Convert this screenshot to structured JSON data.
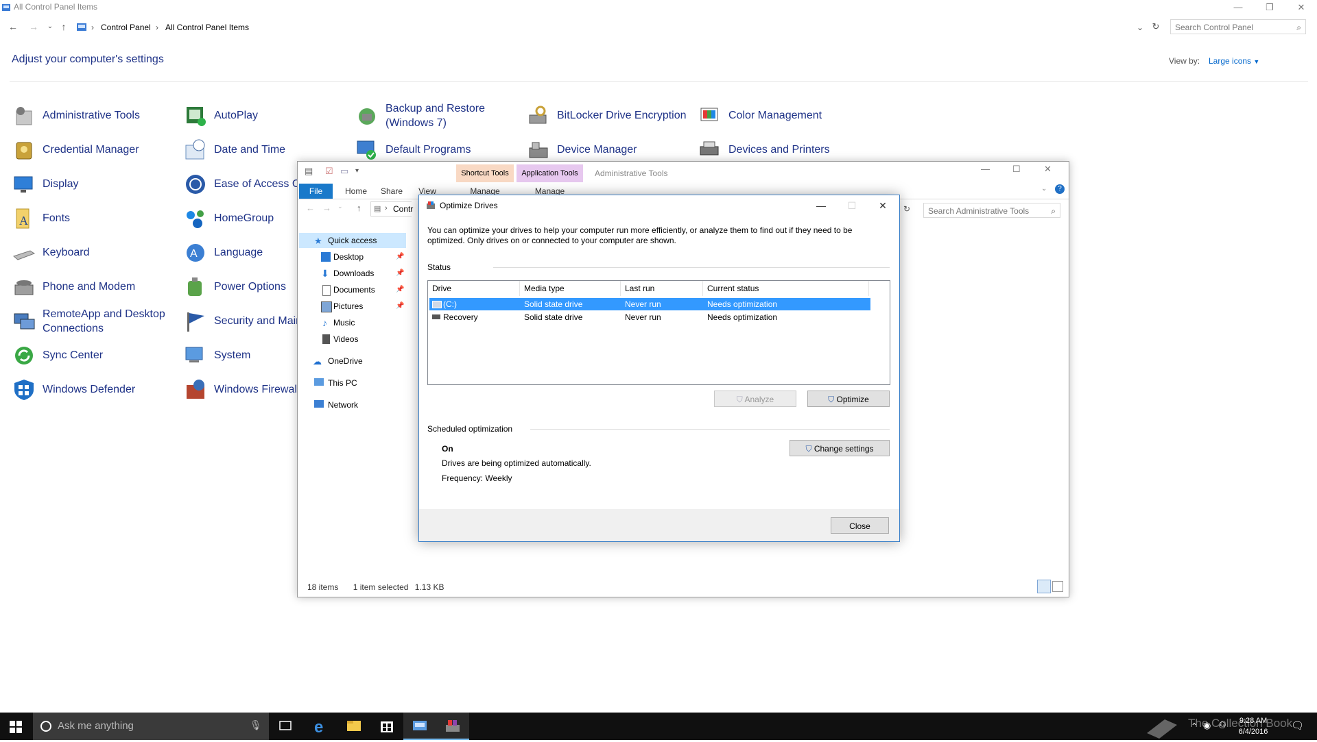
{
  "cp": {
    "title": "All Control Panel Items",
    "breadcrumb": [
      "Control Panel",
      "All Control Panel Items"
    ],
    "search_placeholder": "Search Control Panel",
    "heading": "Adjust your computer's settings",
    "view_by_label": "View by:",
    "view_by_value": "Large icons",
    "items": [
      {
        "label": "Administrative Tools",
        "icon": "admin-tools-icon"
      },
      {
        "label": "AutoPlay",
        "icon": "autoplay-icon"
      },
      {
        "label": "Backup and Restore",
        "label2": "(Windows 7)",
        "icon": "backup-icon"
      },
      {
        "label": "BitLocker Drive Encryption",
        "icon": "bitlocker-icon"
      },
      {
        "label": "Color Management",
        "icon": "color-management-icon"
      },
      {
        "label": "Credential Manager",
        "icon": "credential-manager-icon"
      },
      {
        "label": "Date and Time",
        "icon": "date-time-icon"
      },
      {
        "label": "Default Programs",
        "icon": "default-programs-icon"
      },
      {
        "label": "Device Manager",
        "icon": "device-manager-icon"
      },
      {
        "label": "Devices and Printers",
        "icon": "devices-printers-icon"
      },
      {
        "label": "Display",
        "icon": "display-icon"
      },
      {
        "label": "Ease of Access Ce",
        "icon": "ease-of-access-icon"
      },
      {
        "label": "Fonts",
        "icon": "fonts-icon"
      },
      {
        "label": "HomeGroup",
        "icon": "homegroup-icon"
      },
      {
        "label": "Keyboard",
        "icon": "keyboard-icon"
      },
      {
        "label": "Language",
        "icon": "language-icon"
      },
      {
        "label": "Phone and Modem",
        "icon": "phone-modem-icon"
      },
      {
        "label": "Power Options",
        "icon": "power-options-icon"
      },
      {
        "label": "RemoteApp and Desktop",
        "label2": "Connections",
        "icon": "remoteapp-icon"
      },
      {
        "label": "Security and Mair",
        "icon": "security-maintenance-icon"
      },
      {
        "label": "Sync Center",
        "icon": "sync-center-icon"
      },
      {
        "label": "System",
        "icon": "system-icon"
      },
      {
        "label": "Windows Defender",
        "icon": "windows-defender-icon"
      },
      {
        "label": "Windows Firewall",
        "icon": "windows-firewall-icon"
      }
    ]
  },
  "explorer": {
    "title": "Administrative Tools",
    "context_tabs": [
      {
        "group": "Shortcut Tools",
        "tab": "Manage",
        "color": "#f9d9c4"
      },
      {
        "group": "Application Tools",
        "tab": "Manage",
        "color": "#e7c8ef"
      }
    ],
    "ribbon_tabs": [
      "File",
      "Home",
      "Share",
      "View"
    ],
    "address_partial": "Contr",
    "search_placeholder": "Search Administrative Tools",
    "nav": {
      "quick_access": "Quick access",
      "pinned": [
        "Desktop",
        "Downloads",
        "Documents",
        "Pictures"
      ],
      "unpinned": [
        "Music",
        "Videos"
      ],
      "onedrive": "OneDrive",
      "this_pc": "This PC",
      "network": "Network"
    },
    "status": {
      "items": "18 items",
      "selected": "1 item selected",
      "size": "1.13 KB"
    }
  },
  "dialog": {
    "title": "Optimize Drives",
    "description": "You can optimize your drives to help your computer run more efficiently, or analyze them to find out if they need to be optimized. Only drives on or connected to your computer are shown.",
    "status_label": "Status",
    "columns": [
      "Drive",
      "Media type",
      "Last run",
      "Current status"
    ],
    "drives": [
      {
        "drive": "(C:)",
        "media": "Solid state drive",
        "last_run": "Never run",
        "status": "Needs optimization",
        "selected": true
      },
      {
        "drive": "Recovery",
        "media": "Solid state drive",
        "last_run": "Never run",
        "status": "Needs optimization",
        "selected": false
      }
    ],
    "analyze_label": "Analyze",
    "optimize_label": "Optimize",
    "scheduled_label": "Scheduled optimization",
    "scheduled_state": "On",
    "scheduled_desc": "Drives are being optimized automatically.",
    "frequency": "Frequency: Weekly",
    "change_settings_label": "Change settings",
    "close_label": "Close"
  },
  "taskbar": {
    "search_placeholder": "Ask me anything",
    "time": "9:28 AM",
    "date": "6/4/2016",
    "watermark": "The Collection Book"
  }
}
